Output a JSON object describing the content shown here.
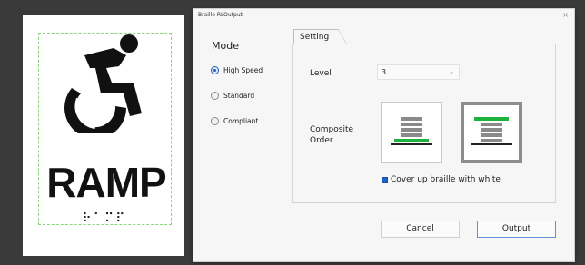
{
  "document": {
    "sign_text": "RAMP",
    "braille_text": "⠗⠁⠍⠏"
  },
  "dialog": {
    "title": "Braille RLOutput",
    "close_glyph": "×",
    "mode": {
      "label": "Mode",
      "options": [
        {
          "label": "High Speed",
          "selected": true
        },
        {
          "label": "Standard",
          "selected": false
        },
        {
          "label": "Compliant",
          "selected": false
        }
      ]
    },
    "tab_label": "Setting",
    "level": {
      "label": "Level",
      "value": "3"
    },
    "composite_order": {
      "label_line1": "Composite",
      "label_line2": "Order",
      "options": [
        {
          "name": "braille-under-stack",
          "selected": false
        },
        {
          "name": "braille-over-stack",
          "selected": true
        }
      ]
    },
    "cover_checkbox": {
      "label": "Cover up braille with white",
      "checked": true
    },
    "buttons": {
      "cancel": "Cancel",
      "output": "Output"
    }
  },
  "colors": {
    "accent": "#1a63c9",
    "braille_green": "#1bb33b",
    "stack_gray": "#8a8a8a"
  }
}
